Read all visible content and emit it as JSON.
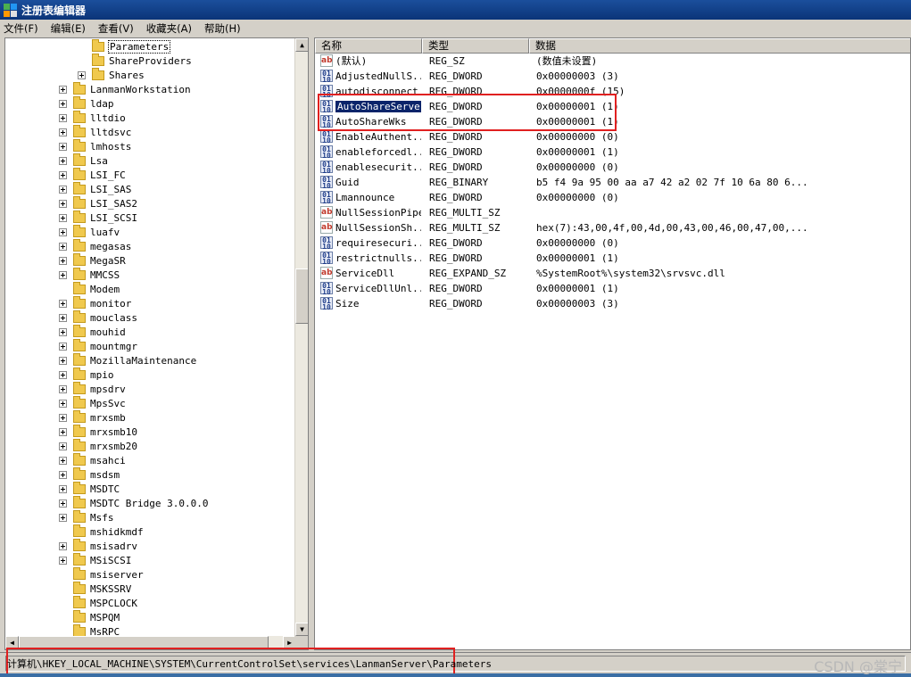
{
  "window": {
    "title": "注册表编辑器"
  },
  "menu": [
    "文件(F)",
    "编辑(E)",
    "查看(V)",
    "收藏夹(A)",
    "帮助(H)"
  ],
  "tree": {
    "items": [
      {
        "label": "Parameters",
        "level": 2,
        "expander": false,
        "selected": true
      },
      {
        "label": "ShareProviders",
        "level": 2,
        "expander": false
      },
      {
        "label": "Shares",
        "level": 2,
        "expander": true
      },
      {
        "label": "LanmanWorkstation",
        "level": 1,
        "expander": true
      },
      {
        "label": "ldap",
        "level": 1,
        "expander": true
      },
      {
        "label": "lltdio",
        "level": 1,
        "expander": true
      },
      {
        "label": "lltdsvc",
        "level": 1,
        "expander": true
      },
      {
        "label": "lmhosts",
        "level": 1,
        "expander": true
      },
      {
        "label": "Lsa",
        "level": 1,
        "expander": true
      },
      {
        "label": "LSI_FC",
        "level": 1,
        "expander": true
      },
      {
        "label": "LSI_SAS",
        "level": 1,
        "expander": true
      },
      {
        "label": "LSI_SAS2",
        "level": 1,
        "expander": true
      },
      {
        "label": "LSI_SCSI",
        "level": 1,
        "expander": true
      },
      {
        "label": "luafv",
        "level": 1,
        "expander": true
      },
      {
        "label": "megasas",
        "level": 1,
        "expander": true
      },
      {
        "label": "MegaSR",
        "level": 1,
        "expander": true
      },
      {
        "label": "MMCSS",
        "level": 1,
        "expander": true
      },
      {
        "label": "Modem",
        "level": 1,
        "expander": false
      },
      {
        "label": "monitor",
        "level": 1,
        "expander": true
      },
      {
        "label": "mouclass",
        "level": 1,
        "expander": true
      },
      {
        "label": "mouhid",
        "level": 1,
        "expander": true
      },
      {
        "label": "mountmgr",
        "level": 1,
        "expander": true
      },
      {
        "label": "MozillaMaintenance",
        "level": 1,
        "expander": true
      },
      {
        "label": "mpio",
        "level": 1,
        "expander": true
      },
      {
        "label": "mpsdrv",
        "level": 1,
        "expander": true
      },
      {
        "label": "MpsSvc",
        "level": 1,
        "expander": true
      },
      {
        "label": "mrxsmb",
        "level": 1,
        "expander": true
      },
      {
        "label": "mrxsmb10",
        "level": 1,
        "expander": true
      },
      {
        "label": "mrxsmb20",
        "level": 1,
        "expander": true
      },
      {
        "label": "msahci",
        "level": 1,
        "expander": true
      },
      {
        "label": "msdsm",
        "level": 1,
        "expander": true
      },
      {
        "label": "MSDTC",
        "level": 1,
        "expander": true
      },
      {
        "label": "MSDTC Bridge 3.0.0.0",
        "level": 1,
        "expander": true
      },
      {
        "label": "Msfs",
        "level": 1,
        "expander": true
      },
      {
        "label": "mshidkmdf",
        "level": 1,
        "expander": false
      },
      {
        "label": "msisadrv",
        "level": 1,
        "expander": true
      },
      {
        "label": "MSiSCSI",
        "level": 1,
        "expander": true
      },
      {
        "label": "msiserver",
        "level": 1,
        "expander": false
      },
      {
        "label": "MSKSSRV",
        "level": 1,
        "expander": false
      },
      {
        "label": "MSPCLOCK",
        "level": 1,
        "expander": false
      },
      {
        "label": "MSPQM",
        "level": 1,
        "expander": false
      },
      {
        "label": "MsRPC",
        "level": 1,
        "expander": false
      }
    ]
  },
  "list": {
    "headers": [
      "名称",
      "类型",
      "数据"
    ],
    "rows": [
      {
        "icon": "sz",
        "name": "(默认)",
        "type": "REG_SZ",
        "data": "(数值未设置)"
      },
      {
        "icon": "bin",
        "name": "AdjustedNullS...",
        "type": "REG_DWORD",
        "data": "0x00000003 (3)"
      },
      {
        "icon": "bin",
        "name": "autodisconnect",
        "type": "REG_DWORD",
        "data": "0x0000000f (15)"
      },
      {
        "icon": "bin",
        "name": "AutoShareServer",
        "type": "REG_DWORD",
        "data": "0x00000001 (1)",
        "selected": true
      },
      {
        "icon": "bin",
        "name": "AutoShareWks",
        "type": "REG_DWORD",
        "data": "0x00000001 (1)"
      },
      {
        "icon": "bin",
        "name": "EnableAuthent...",
        "type": "REG_DWORD",
        "data": "0x00000000 (0)"
      },
      {
        "icon": "bin",
        "name": "enableforcedl...",
        "type": "REG_DWORD",
        "data": "0x00000001 (1)"
      },
      {
        "icon": "bin",
        "name": "enablesecurit...",
        "type": "REG_DWORD",
        "data": "0x00000000 (0)"
      },
      {
        "icon": "bin",
        "name": "Guid",
        "type": "REG_BINARY",
        "data": "b5 f4 9a 95 00 aa a7 42 a2 02 7f 10 6a 80 6..."
      },
      {
        "icon": "bin",
        "name": "Lmannounce",
        "type": "REG_DWORD",
        "data": "0x00000000 (0)"
      },
      {
        "icon": "sz",
        "name": "NullSessionPipes",
        "type": "REG_MULTI_SZ",
        "data": ""
      },
      {
        "icon": "sz",
        "name": "NullSessionSh...",
        "type": "REG_MULTI_SZ",
        "data": "hex(7):43,00,4f,00,4d,00,43,00,46,00,47,00,..."
      },
      {
        "icon": "bin",
        "name": "requiresecuri...",
        "type": "REG_DWORD",
        "data": "0x00000000 (0)"
      },
      {
        "icon": "bin",
        "name": "restrictnulls...",
        "type": "REG_DWORD",
        "data": "0x00000001 (1)"
      },
      {
        "icon": "sz",
        "name": "ServiceDll",
        "type": "REG_EXPAND_SZ",
        "data": "%SystemRoot%\\system32\\srvsvc.dll"
      },
      {
        "icon": "bin",
        "name": "ServiceDllUnl...",
        "type": "REG_DWORD",
        "data": "0x00000001 (1)"
      },
      {
        "icon": "bin",
        "name": "Size",
        "type": "REG_DWORD",
        "data": "0x00000003 (3)"
      }
    ]
  },
  "status": {
    "path": "计算机\\HKEY_LOCAL_MACHINE\\SYSTEM\\CurrentControlSet\\services\\LanmanServer\\Parameters"
  },
  "watermark": "CSDN @棠宁",
  "colors": {
    "highlight": "#e02020",
    "selection": "#0a246a",
    "titlebar": "#0b3478"
  }
}
